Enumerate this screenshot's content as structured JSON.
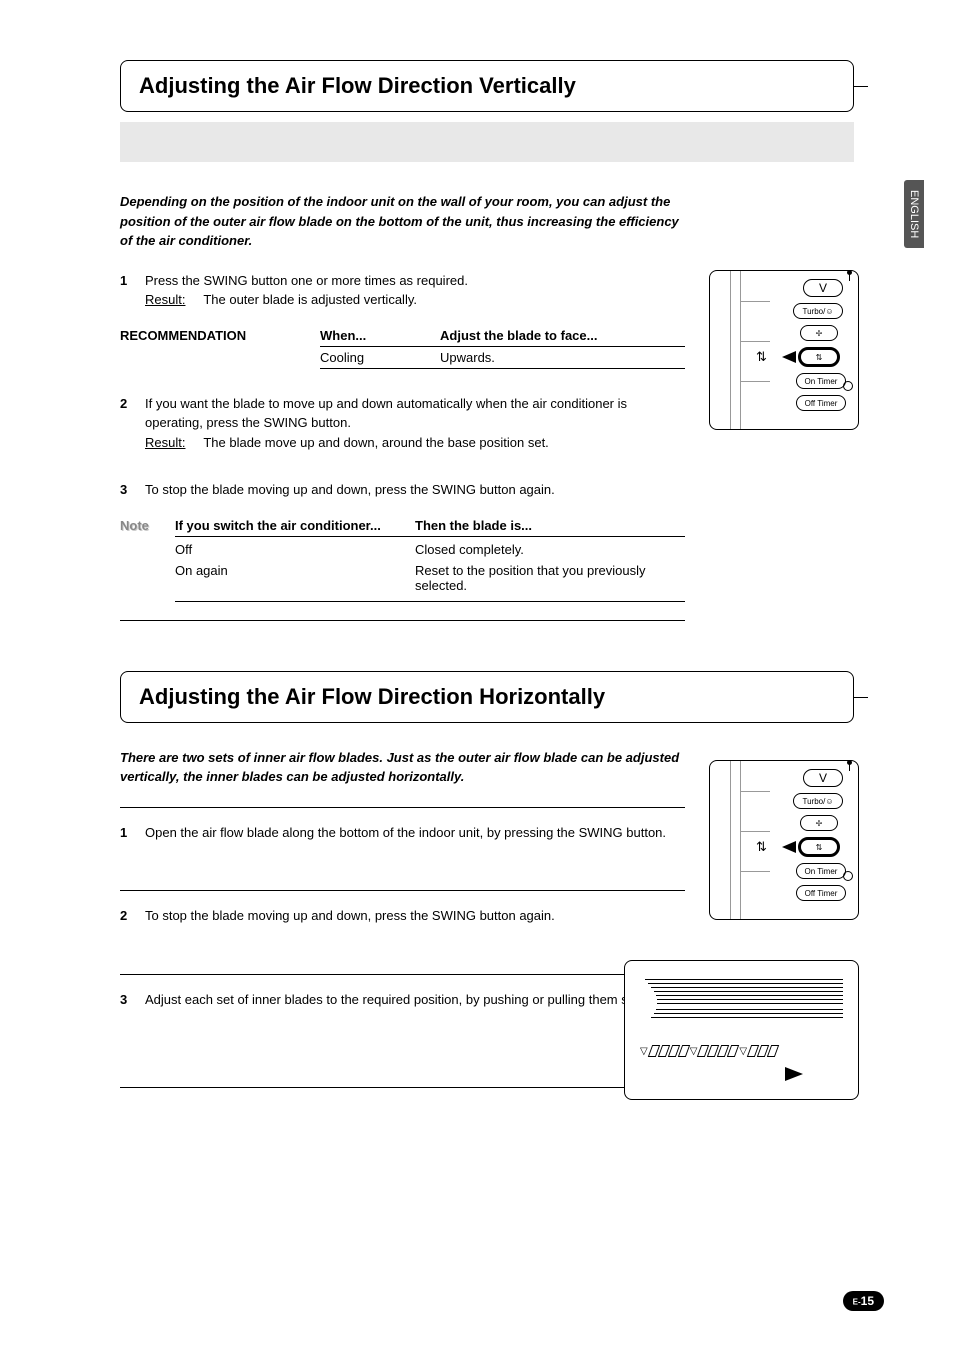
{
  "sideTab": "ENGLISH",
  "section1": {
    "title": "Adjusting the Air Flow Direction Vertically",
    "intro": "Depending on the position of the indoor unit on the wall of your room, you can adjust the position of the outer air flow blade on the bottom of the unit, thus increasing the efficiency of the air conditioner.",
    "step1": {
      "num": "1",
      "text": "Press the SWING button one or more times as required.",
      "resultLabel": "Result:",
      "resultText": "The outer blade is adjusted vertically."
    },
    "recommendation": {
      "label": "RECOMMENDATION",
      "header1": "When...",
      "header2": "Adjust the blade to face...",
      "col1": "Cooling",
      "col2": "Upwards."
    },
    "step2": {
      "num": "2",
      "text": "If you want the blade to move up and down automatically when the air conditioner is operating, press the SWING button.",
      "resultLabel": "Result:",
      "resultText": "The blade move up and down, around the base position set."
    },
    "step3": {
      "num": "3",
      "text": "To stop the blade moving up and down, press the SWING button again."
    },
    "note": {
      "label": "Note",
      "header1": "If you switch the air conditioner...",
      "header2": "Then the blade is...",
      "row1col1": "Off",
      "row1col2": "Closed completely.",
      "row2col1": "On again",
      "row2col2": "Reset to the position that you previously selected."
    }
  },
  "section2": {
    "title": "Adjusting the Air Flow Direction Horizontally",
    "intro": "There are two sets of inner air flow blades. Just as the outer air flow blade can be adjusted vertically, the inner blades can be adjusted horizontally.",
    "step1": {
      "num": "1",
      "text": "Open the air flow blade along the bottom of the indoor unit, by pressing the SWING button."
    },
    "step2": {
      "num": "2",
      "text": "To stop the blade moving up and down, press the SWING button again."
    },
    "step3": {
      "num": "3",
      "text": "Adjust each set of inner blades to the required position, by pushing or pulling them sideways."
    }
  },
  "remote": {
    "v": "V",
    "turbo": "Turbo/",
    "swing": "⇅",
    "onTimer": "On Timer",
    "offTimer": "Off Timer"
  },
  "pageNumber": {
    "prefix": "E-",
    "num": "15"
  }
}
